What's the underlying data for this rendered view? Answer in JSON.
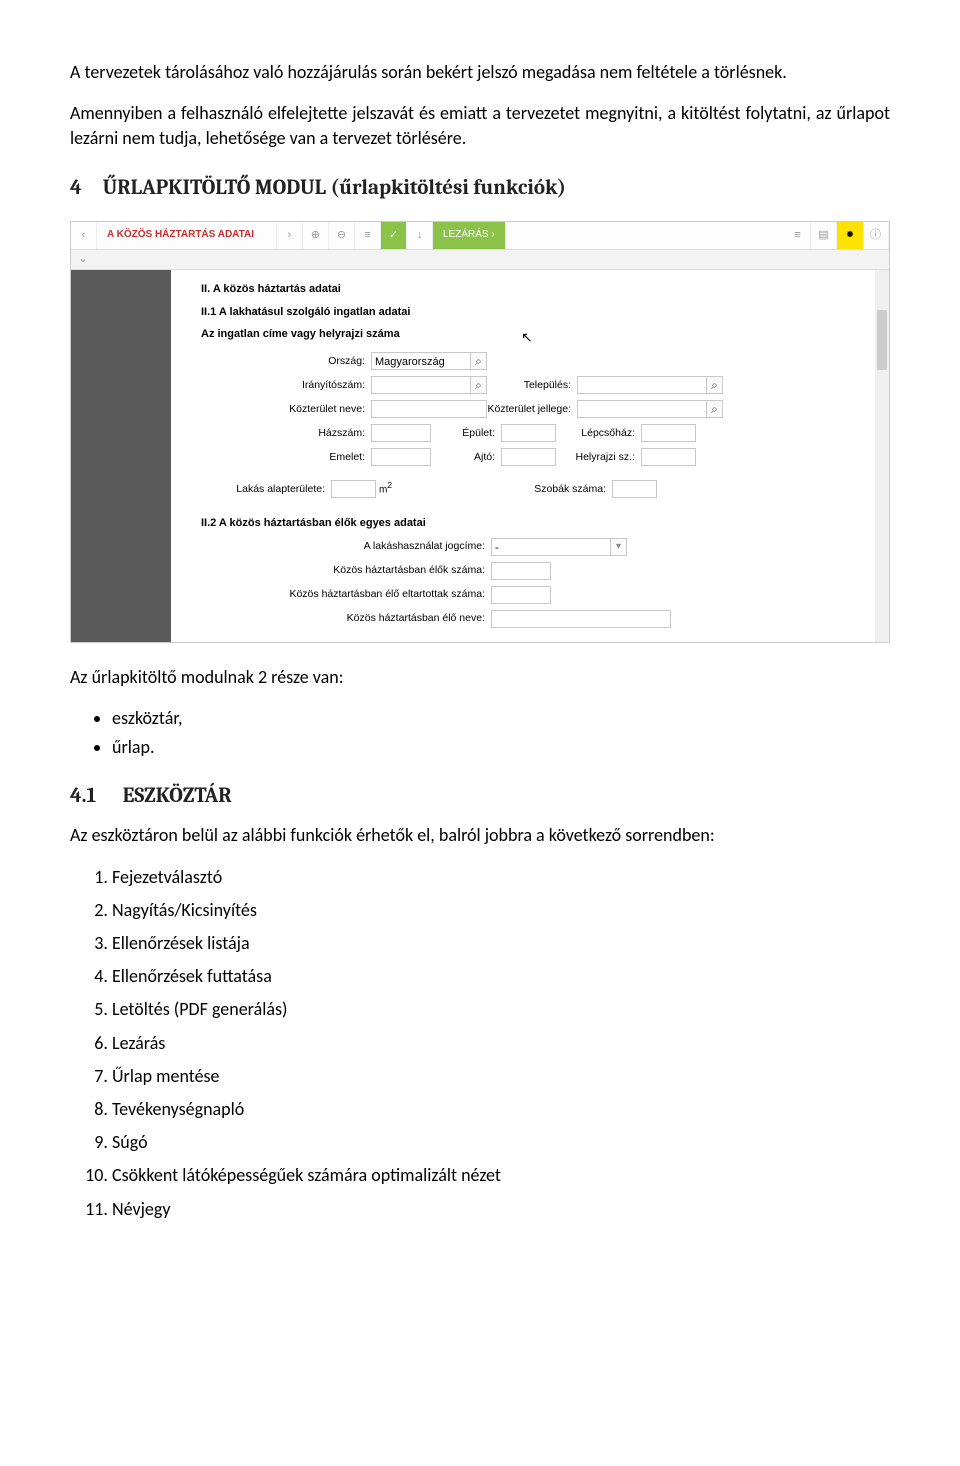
{
  "p1": "A tervezetek tárolásához való hozzájárulás során bekért jelszó megadása nem feltétele a törlésnek.",
  "p2": "Amennyiben a felhasználó elfelejtette jelszavát és emiatt a tervezetet megnyitni, a kitöltést folytatni, az űrlapot lezárni nem tudja, lehetősége van a tervezet törlésére.",
  "h4num": "4",
  "h4title": "ŰRLAPKITÖLTŐ MODUL (űrlapkitöltési funkciók)",
  "screenshot": {
    "toolbar": {
      "title": "A KÖZÖS HÁZTARTÁS ADATAI",
      "close_label": "LEZÁRÁS"
    },
    "form": {
      "sec_title": "II. A közös háztartás adatai",
      "sec_sub1": "II.1 A lakhatásul szolgáló ingatlan adatai",
      "sec_sub2": "Az ingatlan címe vagy helyrajzi száma",
      "orszag_lbl": "Ország:",
      "orszag_val": "Magyarország",
      "iranyito_lbl": "Irányítószám:",
      "telepules_lbl": "Település:",
      "kozterulet_neve_lbl": "Közterület neve:",
      "kozterulet_jellege_lbl": "Közterület jellege:",
      "hazszam_lbl": "Házszám:",
      "epulet_lbl": "Épület:",
      "lepcsohaz_lbl": "Lépcsőház:",
      "emelet_lbl": "Emelet:",
      "ajto_lbl": "Ajtó:",
      "helyrajzi_lbl": "Helyrajzi sz.:",
      "alapterulet_lbl": "Lakás alapterülete:",
      "m2": "m",
      "szobak_lbl": "Szobák száma:",
      "sec_sub3": "II.2 A közös háztartásban élők egyes adatai",
      "jogcim_lbl": "A lakáshasználat jogcíme:",
      "jogcim_val": "-",
      "elok_lbl": "Közös háztartásban élők száma:",
      "eltart_lbl": "Közös háztartásban élő eltartottak száma:",
      "elo_neve_lbl": "Közös háztartásban élő neve:"
    }
  },
  "p3": "Az űrlapkitöltő modulnak 2 része van:",
  "bul1": "eszköztár,",
  "bul2": "űrlap.",
  "h41num": "4.1",
  "h41title": "ESZKÖZTÁR",
  "p4": "Az eszköztáron belül az alábbi funkciók érhetők el, balról jobbra a következő sorrendben:",
  "ol": {
    "i1": "Fejezetválasztó",
    "i2": "Nagyítás/Kicsinyítés",
    "i3": "Ellenőrzések listája",
    "i4": "Ellenőrzések futtatása",
    "i5": "Letöltés (PDF generálás)",
    "i6": "Lezárás",
    "i7": "Űrlap mentése",
    "i8": "Tevékenységnapló",
    "i9": "Súgó",
    "i10": "Csökkent látóképességűek számára optimalizált nézet",
    "i11": "Névjegy"
  }
}
